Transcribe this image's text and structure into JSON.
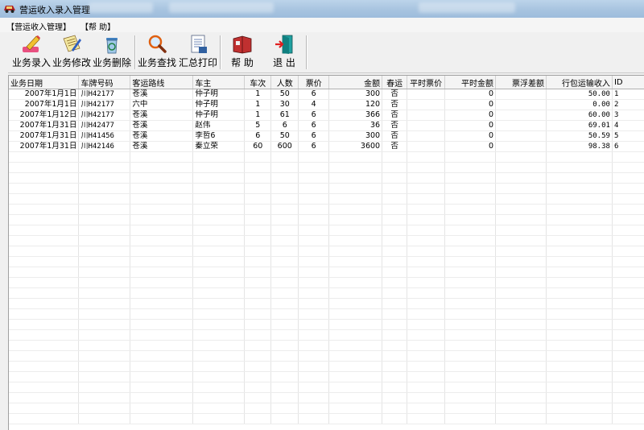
{
  "window": {
    "title": "营运收入录入管理"
  },
  "menu": {
    "items": [
      "【营运收入管理】",
      "【帮 助】"
    ]
  },
  "toolbar": {
    "buttons": [
      {
        "label": "业务录入",
        "icon": "pencil-eraser-icon"
      },
      {
        "label": "业务修改",
        "icon": "edit-document-icon"
      },
      {
        "label": "业务删除",
        "icon": "recycle-bin-icon"
      },
      {
        "label": "业务查找",
        "icon": "magnifier-icon"
      },
      {
        "label": "汇总打印",
        "icon": "print-report-icon"
      },
      {
        "label": "帮 助",
        "icon": "help-book-icon"
      },
      {
        "label": "退 出",
        "icon": "exit-door-icon"
      }
    ]
  },
  "grid": {
    "columns": [
      "业务日期",
      "车牌号码",
      "客运路线",
      "车主",
      "车次",
      "人数",
      "票价",
      "金额",
      "春运",
      "平时票价",
      "平时金额",
      "票浮差额",
      "行包运输收入",
      "ID"
    ],
    "rows": [
      [
        "2007年1月1日",
        "川H42177",
        "苍溪",
        "仲子明",
        "1",
        "50",
        "6",
        "300",
        "否",
        "",
        "0",
        "",
        "50.00",
        "1"
      ],
      [
        "2007年1月1日",
        "川H42177",
        "六中",
        "仲子明",
        "1",
        "30",
        "4",
        "120",
        "否",
        "",
        "0",
        "",
        "0.00",
        "2"
      ],
      [
        "2007年1月12日",
        "川H42177",
        "苍溪",
        "仲子明",
        "1",
        "61",
        "6",
        "366",
        "否",
        "",
        "0",
        "",
        "60.00",
        "3"
      ],
      [
        "2007年1月31日",
        "川H42477",
        "苍溪",
        "赵伟",
        "5",
        "6",
        "6",
        "36",
        "否",
        "",
        "0",
        "",
        "69.01",
        "4"
      ],
      [
        "2007年1月31日",
        "川H41456",
        "苍溪",
        "李哲6",
        "6",
        "50",
        "6",
        "300",
        "否",
        "",
        "0",
        "",
        "50.59",
        "5"
      ],
      [
        "2007年1月31日",
        "川H42146",
        "苍溪",
        "秦立荣",
        "60",
        "600",
        "6",
        "3600",
        "否",
        "",
        "0",
        "",
        "98.38",
        "6"
      ]
    ]
  }
}
